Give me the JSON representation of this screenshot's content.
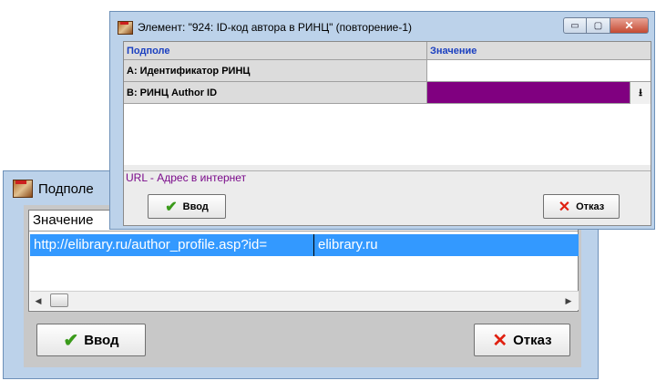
{
  "back_window": {
    "title": "Подполе",
    "column_header": "Значение",
    "row": {
      "col1": "http://elibrary.ru/author_profile.asp?id=",
      "col2": "elibrary.ru"
    },
    "scroll_left_icon": "◀",
    "scroll_right_icon": "▶",
    "ok_label": "Ввод",
    "cancel_label": "Отказ",
    "ok_icon": "✔",
    "cancel_icon": "✕"
  },
  "front_window": {
    "title": "Элемент: \"924: ID-код автора в РИНЦ\" (повторение-1)",
    "controls": {
      "minimize": "▭",
      "maximize": "▢",
      "close": "✕"
    },
    "columns": [
      "Подполе",
      "Значение"
    ],
    "rows": [
      {
        "subfield": "A: Идентификатор РИНЦ",
        "value": ""
      },
      {
        "subfield": "B: РИНЦ Author ID",
        "value": "",
        "dropdown_icon": "⭳"
      }
    ],
    "hint": "URL - Адрес в интернет",
    "ok_label": "Ввод",
    "cancel_label": "Отказ",
    "ok_icon": "✔",
    "cancel_icon": "✕"
  },
  "colors": {
    "titlebar": "#bcd2ea",
    "selection": "#3399ff",
    "selected_value": "#800080",
    "hint_text": "#7a0a8a",
    "header_text": "#1a3fc0"
  }
}
